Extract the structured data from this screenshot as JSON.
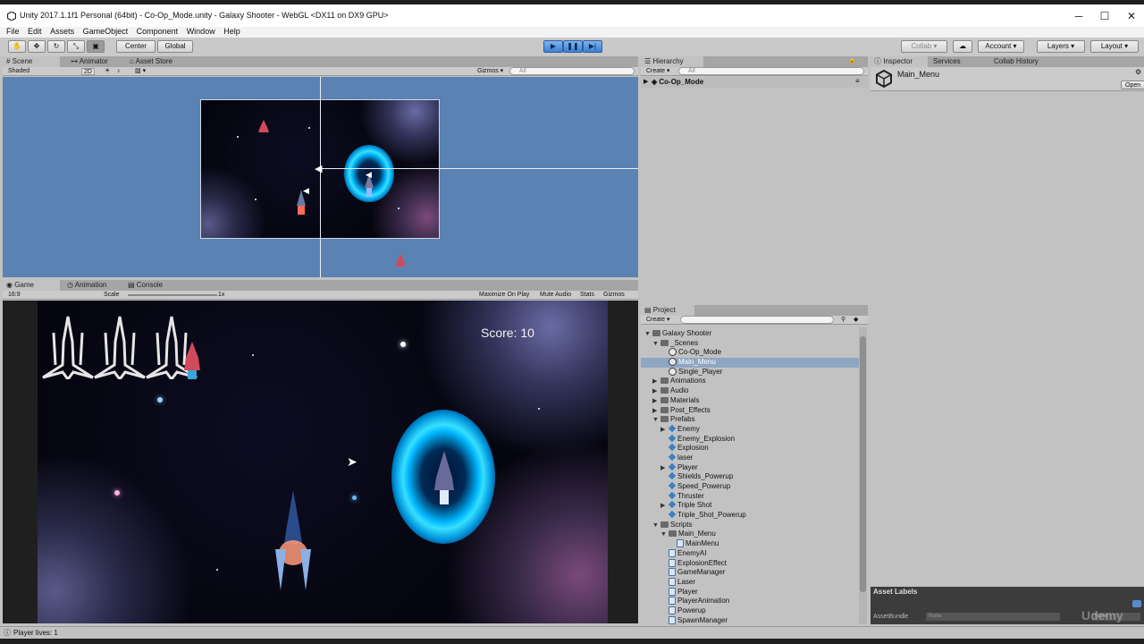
{
  "window": {
    "title": "Unity 2017.1.1f1 Personal (64bit) - Co-Op_Mode.unity - Galaxy Shooter - WebGL <DX11 on DX9 GPU>",
    "minimize": "─",
    "maximize": "☐",
    "close": "✕"
  },
  "menu": [
    "File",
    "Edit",
    "Assets",
    "GameObject",
    "Component",
    "Window",
    "Help"
  ],
  "toolbar": {
    "center": "Center",
    "global": "Global",
    "collab": "Collab ▾",
    "account": "Account",
    "layers": "Layers",
    "layout": "Layout"
  },
  "scene_panel": {
    "tabs": [
      "Scene",
      "Animator",
      "Asset Store"
    ],
    "shaded": "Shaded",
    "mode2d": "2D",
    "gizmos": "Gizmos ▾",
    "search_placeholder": "All"
  },
  "game_panel": {
    "tabs": [
      "Game",
      "Animation",
      "Console"
    ],
    "aspect": "16:9",
    "scale_label": "Scale",
    "scale_value": "1x",
    "maximize": "Maximize On Play",
    "mute": "Mute Audio",
    "stats": "Stats",
    "gizmos": "Gizmos",
    "score": "Score: 10"
  },
  "hierarchy": {
    "tab": "Hierarchy",
    "create": "Create",
    "search_placeholder": "All",
    "root": "Co-Op_Mode"
  },
  "inspector": {
    "tabs": [
      "Inspector",
      "Services",
      "Collab History"
    ],
    "object_name": "Main_Menu",
    "open": "Open",
    "asset_labels": "Asset Labels",
    "asset_bundle_label": "AssetBundle",
    "asset_bundle_value": "None",
    "asset_bundle_variant": "None"
  },
  "project": {
    "tab": "Project",
    "create": "Create",
    "items": [
      {
        "label": "Galaxy Shooter",
        "indent": 0,
        "icon": "folder",
        "arrow": "▼"
      },
      {
        "label": "_Scenes",
        "indent": 1,
        "icon": "folder",
        "arrow": "▼"
      },
      {
        "label": "Co-Op_Mode",
        "indent": 2,
        "icon": "unity"
      },
      {
        "label": "Main_Menu",
        "indent": 2,
        "icon": "unity",
        "selected": true
      },
      {
        "label": "Single_Player",
        "indent": 2,
        "icon": "unity"
      },
      {
        "label": "Animations",
        "indent": 1,
        "icon": "folder",
        "arrow": "▶"
      },
      {
        "label": "Audio",
        "indent": 1,
        "icon": "folder",
        "arrow": "▶"
      },
      {
        "label": "Materials",
        "indent": 1,
        "icon": "folder",
        "arrow": "▶"
      },
      {
        "label": "Post_Effects",
        "indent": 1,
        "icon": "folder",
        "arrow": "▶"
      },
      {
        "label": "Prefabs",
        "indent": 1,
        "icon": "folder",
        "arrow": "▼"
      },
      {
        "label": "Enemy",
        "indent": 2,
        "icon": "prefab",
        "arrow": "▶"
      },
      {
        "label": "Enemy_Explosion",
        "indent": 2,
        "icon": "prefab"
      },
      {
        "label": "Explosion",
        "indent": 2,
        "icon": "prefab"
      },
      {
        "label": "laser",
        "indent": 2,
        "icon": "prefab"
      },
      {
        "label": "Player",
        "indent": 2,
        "icon": "prefab",
        "arrow": "▶"
      },
      {
        "label": "Shields_Powerup",
        "indent": 2,
        "icon": "prefab"
      },
      {
        "label": "Speed_Powerup",
        "indent": 2,
        "icon": "prefab"
      },
      {
        "label": "Thruster",
        "indent": 2,
        "icon": "prefab"
      },
      {
        "label": "Triple Shot",
        "indent": 2,
        "icon": "prefab",
        "arrow": "▶"
      },
      {
        "label": "Triple_Shot_Powerup",
        "indent": 2,
        "icon": "prefab"
      },
      {
        "label": "Scripts",
        "indent": 1,
        "icon": "folder",
        "arrow": "▼"
      },
      {
        "label": "Main_Menu",
        "indent": 2,
        "icon": "folder",
        "arrow": "▼"
      },
      {
        "label": "MainMenu",
        "indent": 3,
        "icon": "script"
      },
      {
        "label": "EnemyAI",
        "indent": 2,
        "icon": "script"
      },
      {
        "label": "ExplosionEffect",
        "indent": 2,
        "icon": "script"
      },
      {
        "label": "GameManager",
        "indent": 2,
        "icon": "script"
      },
      {
        "label": "Laser",
        "indent": 2,
        "icon": "script"
      },
      {
        "label": "Player",
        "indent": 2,
        "icon": "script"
      },
      {
        "label": "PlayerAnimation",
        "indent": 2,
        "icon": "script"
      },
      {
        "label": "Powerup",
        "indent": 2,
        "icon": "script"
      },
      {
        "label": "SpawnManager",
        "indent": 2,
        "icon": "script"
      }
    ]
  },
  "status": {
    "text": "Player lives: 1"
  },
  "watermark": "Udemy"
}
